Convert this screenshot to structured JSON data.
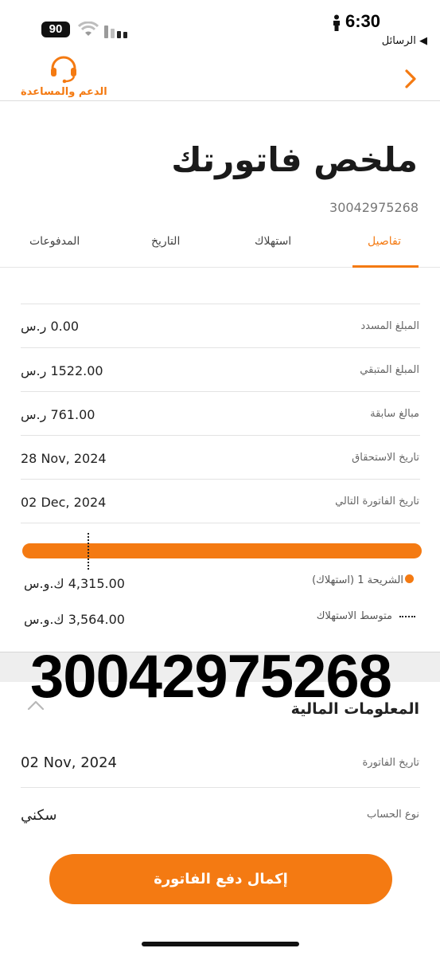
{
  "status_bar": {
    "battery": "90",
    "time": "6:30",
    "back_app": "◀ الرسائل"
  },
  "header": {
    "support_label": "الدعم والمساعدة",
    "title": "ملخص فاتورتك",
    "account_number": "30042975268"
  },
  "tabs": [
    {
      "label": "تفاصيل",
      "active": true
    },
    {
      "label": "استهلاك",
      "active": false
    },
    {
      "label": "التاريخ",
      "active": false
    },
    {
      "label": "المدفوعات",
      "active": false
    }
  ],
  "details": [
    {
      "label": "المبلغ المسدد",
      "value": "0.00 ر.س"
    },
    {
      "label": "المبلغ المتبقي",
      "value": "1522.00 ر.س"
    },
    {
      "label": "مبالغ سابقة",
      "value": "761.00 ر.س"
    },
    {
      "label": "تاريخ الاستحقاق",
      "value": "28 Nov, 2024"
    },
    {
      "label": "تاريخ الفاتورة التالي",
      "value": "02 Dec, 2024"
    }
  ],
  "usage": {
    "tier_label": "الشريحة 1 (استهلاك)",
    "tier_value": "4,315.00 ك.و.س",
    "avg_label": "متوسط الاستهلاك",
    "avg_value": "3,564.00 ك.و.س"
  },
  "overlay_number": "30042975268",
  "financial": {
    "title": "المعلومات المالية",
    "rows": [
      {
        "label": "تاريخ الفاتورة",
        "value": "02 Nov, 2024"
      },
      {
        "label": "نوع الحساب",
        "value": "سكني"
      }
    ]
  },
  "cta_label": "إكمال دفع الفاتورة",
  "colors": {
    "accent": "#f47a12",
    "text": "#1a1a1a",
    "muted": "#666666"
  },
  "icons": [
    "headset-icon",
    "chevron-right-icon",
    "chevron-up-icon",
    "wifi-icon",
    "signal-icon",
    "person-icon"
  ]
}
